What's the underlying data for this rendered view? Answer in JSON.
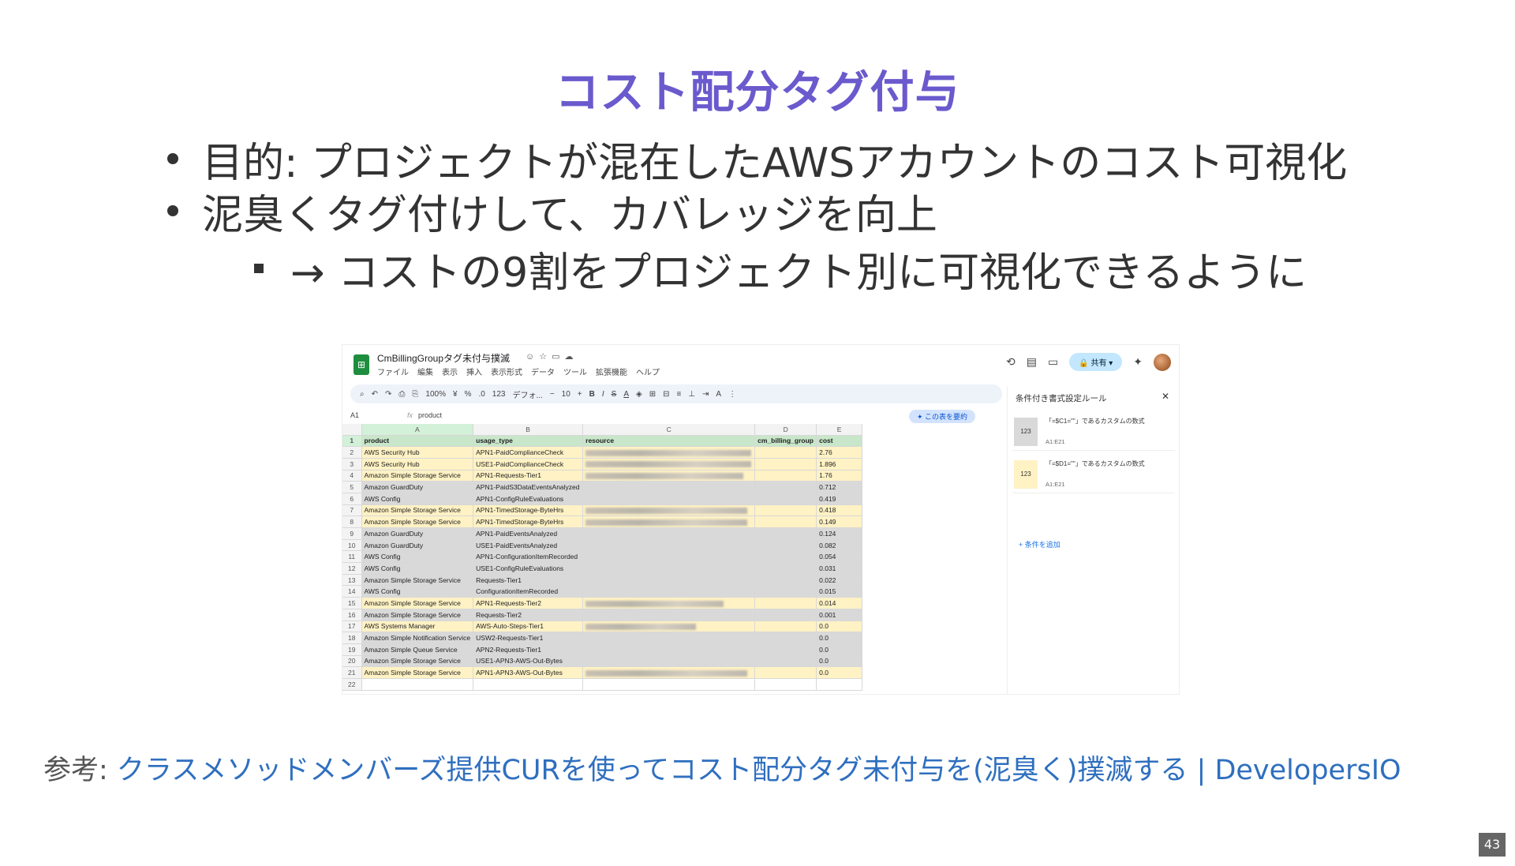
{
  "slide": {
    "title": "コスト配分タグ付与",
    "bullets": [
      "目的: プロジェクトが混在したAWSアカウントのコスト可視化",
      "泥臭くタグ付けして、カバレッジを向上"
    ],
    "sub_bullet": "→ コストの9割をプロジェクト別に可視化できるように",
    "reference_label": "参考: ",
    "reference_link": "クラスメソッドメンバーズ提供CURを使ってコスト配分タグ未付与を(泥臭く)撲滅する | DevelopersIO",
    "page_number": "43"
  },
  "sheet": {
    "doc_title": "CmBillingGroupタグ未付与撲滅",
    "menu": [
      "ファイル",
      "編集",
      "表示",
      "挿入",
      "表示形式",
      "データ",
      "ツール",
      "拡張機能",
      "ヘルプ"
    ],
    "share_label": "共有",
    "toolbar_zoom": "100%",
    "toolbar_font": "デフォ...",
    "toolbar_font_size": "10",
    "cell_ref": "A1",
    "formula_value": "product",
    "summarize_label": "この表を要約",
    "columns": [
      "A",
      "B",
      "C",
      "D",
      "E"
    ],
    "headers": [
      "product",
      "usage_type",
      "resource",
      "cm_billing_group",
      "cost"
    ],
    "rows": [
      {
        "n": "2",
        "product": "AWS Security Hub",
        "usage": "APN1-PaidComplianceCheck",
        "cost": "2.76",
        "hl": "y",
        "res": 210
      },
      {
        "n": "3",
        "product": "AWS Security Hub",
        "usage": "USE1-PaidComplianceCheck",
        "cost": "1.896",
        "hl": "y",
        "res": 210
      },
      {
        "n": "4",
        "product": "Amazon Simple Storage Service",
        "usage": "APN1-Requests-Tier1",
        "cost": "1.76",
        "hl": "y",
        "res": 200
      },
      {
        "n": "5",
        "product": "Amazon GuardDuty",
        "usage": "APN1-PaidS3DataEventsAnalyzed",
        "cost": "0.712",
        "hl": "g",
        "res": 0
      },
      {
        "n": "6",
        "product": "AWS Config",
        "usage": "APN1-ConfigRuleEvaluations",
        "cost": "0.419",
        "hl": "g",
        "res": 0
      },
      {
        "n": "7",
        "product": "Amazon Simple Storage Service",
        "usage": "APN1-TimedStorage-ByteHrs",
        "cost": "0.418",
        "hl": "y",
        "res": 205
      },
      {
        "n": "8",
        "product": "Amazon Simple Storage Service",
        "usage": "APN1-TimedStorage-ByteHrs",
        "cost": "0.149",
        "hl": "y",
        "res": 205
      },
      {
        "n": "9",
        "product": "Amazon GuardDuty",
        "usage": "APN1-PaidEventsAnalyzed",
        "cost": "0.124",
        "hl": "g",
        "res": 0
      },
      {
        "n": "10",
        "product": "Amazon GuardDuty",
        "usage": "USE1-PaidEventsAnalyzed",
        "cost": "0.082",
        "hl": "g",
        "res": 0
      },
      {
        "n": "11",
        "product": "AWS Config",
        "usage": "APN1-ConfigurationItemRecorded",
        "cost": "0.054",
        "hl": "g",
        "res": 0
      },
      {
        "n": "12",
        "product": "AWS Config",
        "usage": "USE1-ConfigRuleEvaluations",
        "cost": "0.031",
        "hl": "g",
        "res": 0
      },
      {
        "n": "13",
        "product": "Amazon Simple Storage Service",
        "usage": "Requests-Tier1",
        "cost": "0.022",
        "hl": "g",
        "res": 0
      },
      {
        "n": "14",
        "product": "AWS Config",
        "usage": "ConfigurationItemRecorded",
        "cost": "0.015",
        "hl": "g",
        "res": 0
      },
      {
        "n": "15",
        "product": "Amazon Simple Storage Service",
        "usage": "APN1-Requests-Tier2",
        "cost": "0.014",
        "hl": "y",
        "res": 175
      },
      {
        "n": "16",
        "product": "Amazon Simple Storage Service",
        "usage": "Requests-Tier2",
        "cost": "0.001",
        "hl": "g",
        "res": 0
      },
      {
        "n": "17",
        "product": "AWS Systems Manager",
        "usage": "AWS-Auto-Steps-Tier1",
        "cost": "0.0",
        "hl": "y",
        "res": 140
      },
      {
        "n": "18",
        "product": "Amazon Simple Notification Service",
        "usage": "USW2-Requests-Tier1",
        "cost": "0.0",
        "hl": "g",
        "res": 0
      },
      {
        "n": "19",
        "product": "Amazon Simple Queue Service",
        "usage": "APN2-Requests-Tier1",
        "cost": "0.0",
        "hl": "g",
        "res": 0
      },
      {
        "n": "20",
        "product": "Amazon Simple Storage Service",
        "usage": "USE1-APN3-AWS-Out-Bytes",
        "cost": "0.0",
        "hl": "g",
        "res": 0
      },
      {
        "n": "21",
        "product": "Amazon Simple Storage Service",
        "usage": "APN1-APN3-AWS-Out-Bytes",
        "cost": "0.0",
        "hl": "y",
        "res": 205
      },
      {
        "n": "22",
        "product": "",
        "usage": "",
        "cost": "",
        "hl": "",
        "res": 0
      }
    ],
    "side_panel": {
      "title": "条件付き書式設定ルール",
      "rule1_text": "「=$C1=\"\"」であるカスタムの数式",
      "rule1_range": "A1:E21",
      "rule1_swatch": "123",
      "rule2_text": "「=$D1=\"\"」であるカスタムの数式",
      "rule2_range": "A1:E21",
      "rule2_swatch": "123",
      "add_rule": "+ 条件を追加"
    }
  }
}
